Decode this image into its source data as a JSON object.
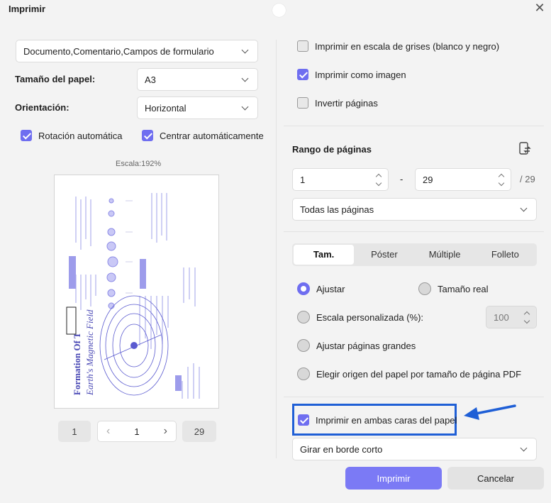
{
  "dialog": {
    "title": "Imprimir",
    "close_icon": "close-icon"
  },
  "left": {
    "content_select": "Documento,Comentario,Campos de formulario",
    "paper_size_label": "Tamaño del papel:",
    "paper_size_value": "A3",
    "orientation_label": "Orientación:",
    "orientation_value": "Horizontal",
    "auto_rotate_label": "Rotación automática",
    "auto_rotate_checked": true,
    "auto_center_label": "Centrar automáticamente",
    "auto_center_checked": true,
    "scale_text": "Escala:192%",
    "preview": {
      "title_line1": "Formation Of T",
      "title_line2": "Earth's Magnetic Field"
    },
    "pager": {
      "first": "1",
      "current": "1",
      "last": "29"
    }
  },
  "right": {
    "grayscale_label": "Imprimir en escala de grises (blanco y negro)",
    "grayscale_checked": false,
    "as_image_label": "Imprimir como imagen",
    "as_image_checked": true,
    "invert_label": "Invertir páginas",
    "invert_checked": false,
    "range_title": "Rango de páginas",
    "range_from": "1",
    "range_dash": "-",
    "range_to": "29",
    "range_total": "/ 29",
    "range_select": "Todas las páginas",
    "tabs": [
      "Tam.",
      "Póster",
      "Múltiple",
      "Folleto"
    ],
    "active_tab": "Tam.",
    "fit_label": "Ajustar",
    "actual_size_label": "Tamaño real",
    "custom_scale_label": "Escala personalizada (%):",
    "custom_scale_value": "100",
    "fit_large_label": "Ajustar páginas grandes",
    "choose_source_label": "Elegir origen del papel por tamaño de página PDF",
    "duplex_label": "Imprimir en ambas caras del papel",
    "duplex_checked": true,
    "flip_select": "Girar en borde corto"
  },
  "footer": {
    "print_label": "Imprimir",
    "cancel_label": "Cancelar"
  },
  "colors": {
    "accent": "#6f6ef0",
    "highlight_border": "#1f5fd6",
    "arrow": "#1f5fd6"
  }
}
